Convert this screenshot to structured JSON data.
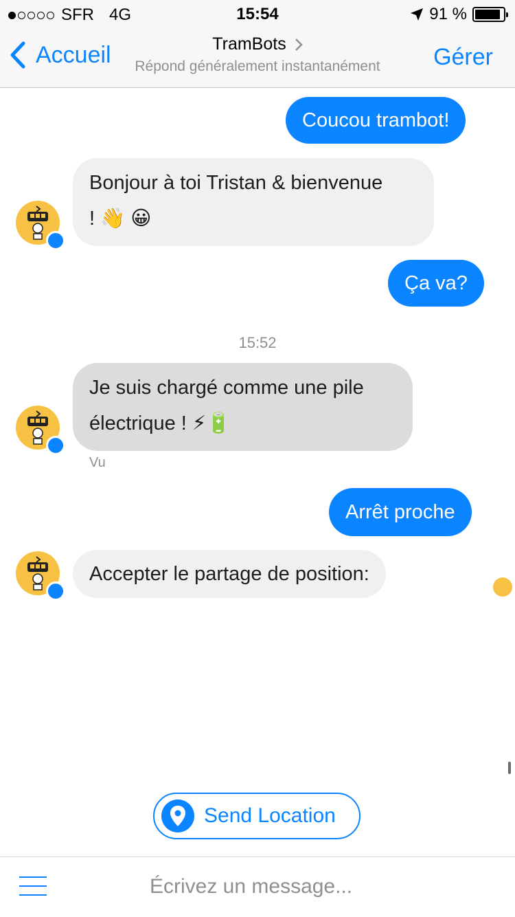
{
  "status": {
    "carrier": "SFR",
    "network": "4G",
    "time": "15:54",
    "battery": "91 %",
    "signal_bars": 1,
    "battery_level": 0.91
  },
  "nav": {
    "back_label": "Accueil",
    "title": "TramBots",
    "subtitle": "Répond généralement instantanément",
    "manage_label": "Gérer"
  },
  "messages": [
    {
      "from": "user",
      "text": "Coucou trambot!"
    },
    {
      "from": "bot",
      "line1": "Bonjour à toi Tristan & bienvenue",
      "line2": "! 👋 😀"
    },
    {
      "from": "user",
      "text": "Ça va?"
    },
    {
      "from": "bot",
      "line1": "Je suis chargé comme une pile",
      "line2": "électrique ! ⚡🔋"
    },
    {
      "from": "user",
      "text": "Arrêt proche"
    },
    {
      "from": "bot",
      "text": "Accepter le partage de position:"
    }
  ],
  "timestamp": "15:52",
  "seen_label": "Vu",
  "quick_reply": {
    "label": "Send Location"
  },
  "composer": {
    "placeholder": "Écrivez un message..."
  },
  "colors": {
    "accent": "#0a84ff",
    "bot_avatar": "#f7c244"
  },
  "icons": [
    "chevron-left-icon",
    "chevron-right-icon",
    "location-arrow-icon",
    "battery-icon",
    "messenger-badge-icon",
    "map-pin-icon",
    "menu-icon"
  ]
}
